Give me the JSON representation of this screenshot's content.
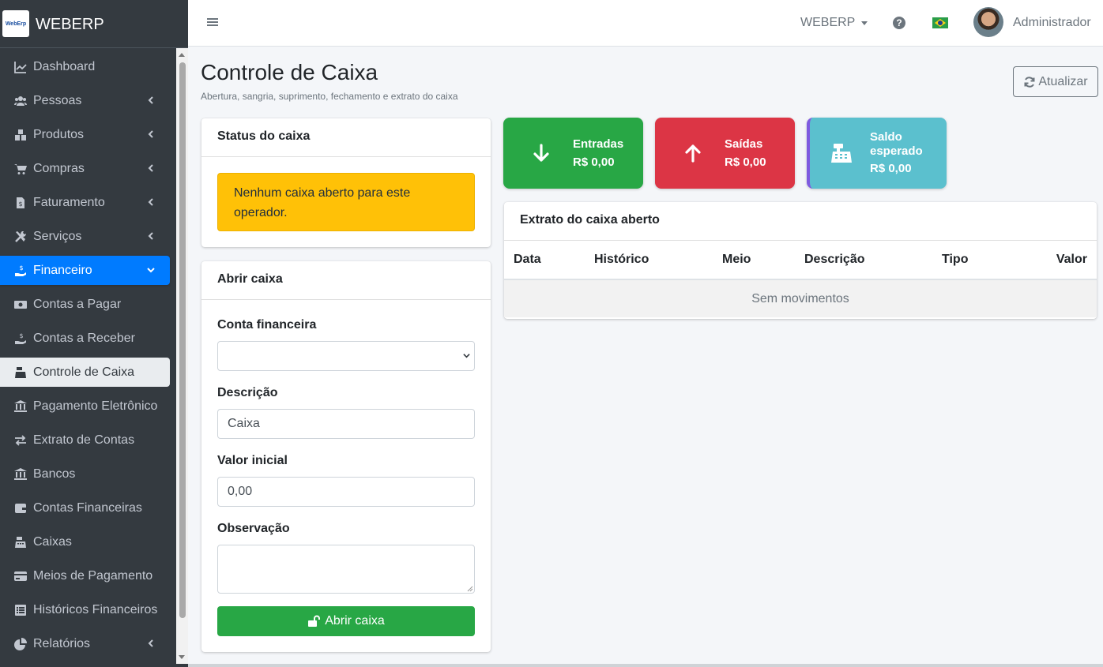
{
  "brand": {
    "name": "WEBERP",
    "logo_text": "WebErp"
  },
  "sidebar": {
    "items": [
      {
        "label": "Dashboard",
        "icon": "chart-line-icon",
        "has_arrow": false,
        "state": ""
      },
      {
        "label": "Pessoas",
        "icon": "users-icon",
        "has_arrow": true,
        "state": ""
      },
      {
        "label": "Produtos",
        "icon": "boxes-icon",
        "has_arrow": true,
        "state": ""
      },
      {
        "label": "Compras",
        "icon": "cart-icon",
        "has_arrow": true,
        "state": ""
      },
      {
        "label": "Faturamento",
        "icon": "invoice-icon",
        "has_arrow": true,
        "state": ""
      },
      {
        "label": "Serviços",
        "icon": "tools-icon",
        "has_arrow": true,
        "state": ""
      },
      {
        "label": "Financeiro",
        "icon": "hand-dollar-icon",
        "has_arrow": true,
        "state": "active"
      },
      {
        "label": "Contas a Pagar",
        "icon": "money-bill-icon",
        "has_arrow": false,
        "state": ""
      },
      {
        "label": "Contas a Receber",
        "icon": "hand-dollar-icon",
        "has_arrow": false,
        "state": ""
      },
      {
        "label": "Controle de Caixa",
        "icon": "cash-register-icon",
        "has_arrow": false,
        "state": "current"
      },
      {
        "label": "Pagamento Eletrônico",
        "icon": "bank-icon",
        "has_arrow": false,
        "state": ""
      },
      {
        "label": "Extrato de Contas",
        "icon": "exchange-icon",
        "has_arrow": false,
        "state": ""
      },
      {
        "label": "Bancos",
        "icon": "bank-icon",
        "has_arrow": false,
        "state": ""
      },
      {
        "label": "Contas Financeiras",
        "icon": "wallet-icon",
        "has_arrow": false,
        "state": ""
      },
      {
        "label": "Caixas",
        "icon": "cash-register-icon",
        "has_arrow": false,
        "state": ""
      },
      {
        "label": "Meios de Pagamento",
        "icon": "credit-card-icon",
        "has_arrow": false,
        "state": ""
      },
      {
        "label": "Históricos Financeiros",
        "icon": "list-icon",
        "has_arrow": false,
        "state": ""
      },
      {
        "label": "Relatórios",
        "icon": "pie-chart-icon",
        "has_arrow": true,
        "state": ""
      }
    ]
  },
  "topbar": {
    "company": "WEBERP",
    "user": "Administrador"
  },
  "page": {
    "title": "Controle de Caixa",
    "subtitle": "Abertura, sangria, suprimento, fechamento e extrato do caixa",
    "refresh_label": "Atualizar"
  },
  "status_card": {
    "title": "Status do caixa",
    "message": "Nenhum caixa aberto para este operador."
  },
  "open_form": {
    "title": "Abrir caixa",
    "account_label": "Conta financeira",
    "account_value": "",
    "description_label": "Descrição",
    "description_value": "Caixa",
    "initial_label": "Valor inicial",
    "initial_value": "0,00",
    "notes_label": "Observação",
    "notes_value": "",
    "submit_label": "Abrir caixa"
  },
  "stats": {
    "entradas": {
      "label": "Entradas",
      "value": "R$ 0,00",
      "color": "#28a745"
    },
    "saidas": {
      "label": "Saídas",
      "value": "R$ 0,00",
      "color": "#dc3545"
    },
    "saldo": {
      "label_line1": "Saldo",
      "label_line2": "esperado",
      "value": "R$ 0,00",
      "color": "#5bc0ce"
    }
  },
  "statement": {
    "title": "Extrato do caixa aberto",
    "columns": [
      "Data",
      "Histórico",
      "Meio",
      "Descrição",
      "Tipo",
      "Valor"
    ],
    "empty": "Sem movimentos"
  }
}
